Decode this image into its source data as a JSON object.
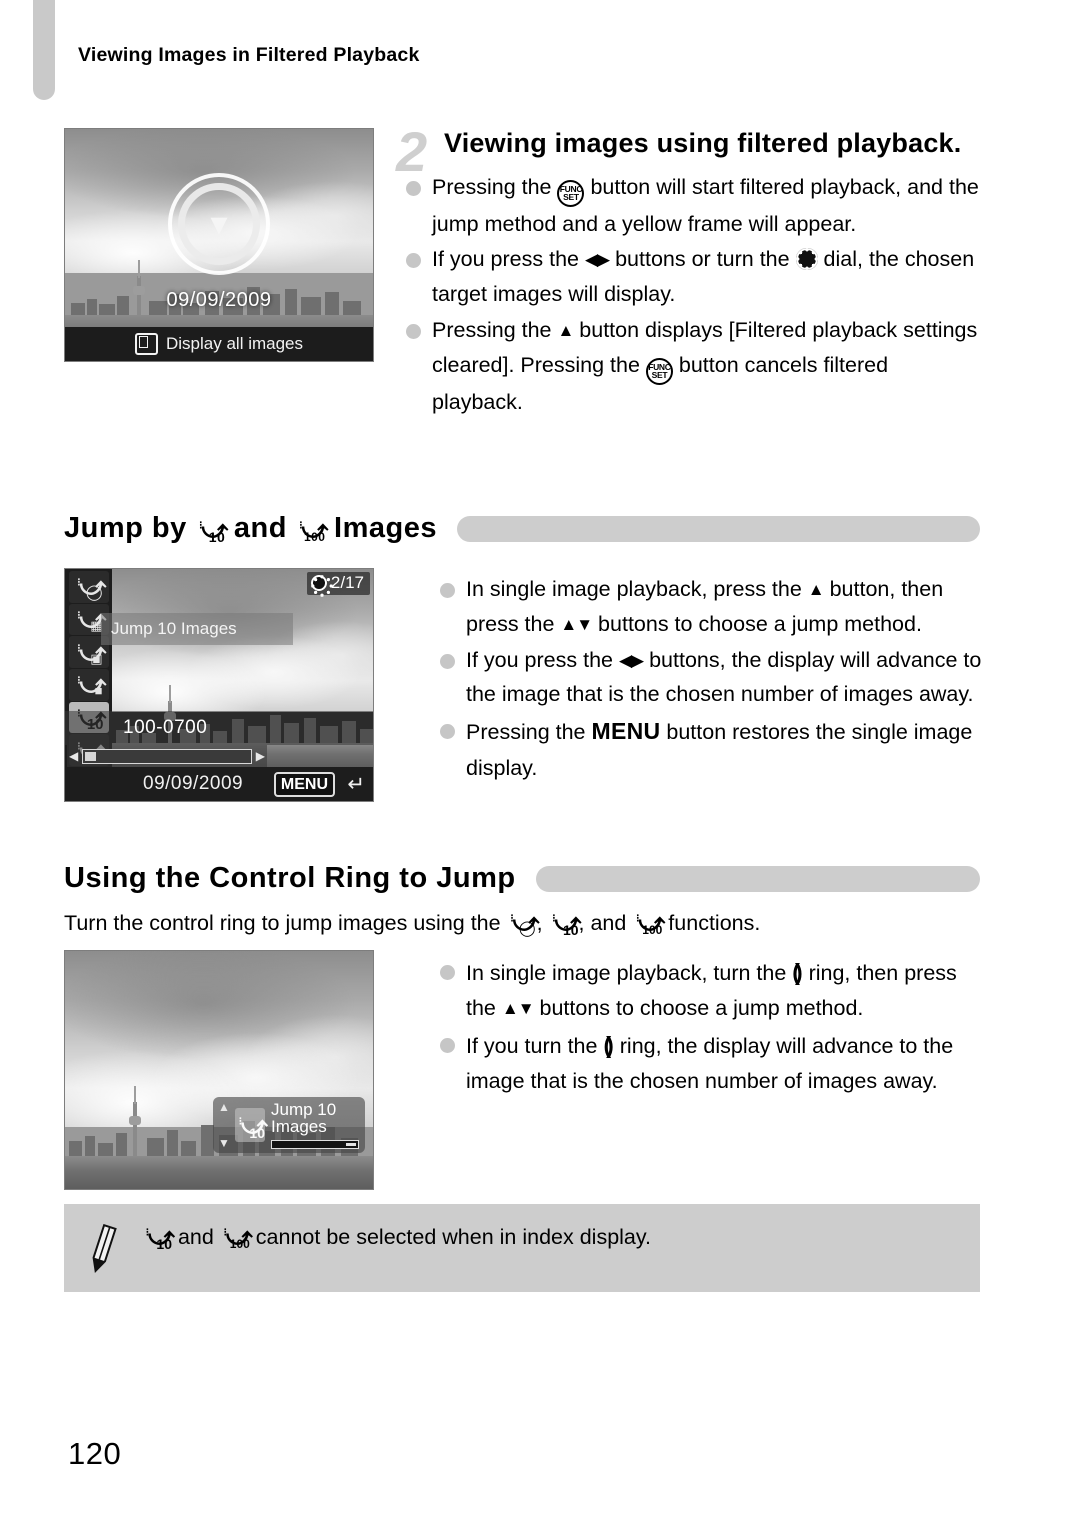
{
  "page": {
    "running_header": "Viewing Images in Filtered Playback",
    "page_number": "120"
  },
  "step": {
    "number": "2",
    "title": "Viewing images using filtered playback.",
    "bullets": [
      {
        "pre": "Pressing the ",
        "icon": "func-set-button-icon",
        "post": " button will start filtered playback, and the jump method and a yellow frame will appear."
      },
      {
        "pre": "If you press the ",
        "icon": "left-right-buttons-icon",
        "mid": " buttons or turn the ",
        "icon2": "control-dial-icon",
        "post": " dial, the chosen target images will display."
      },
      {
        "pre": "Pressing the ",
        "icon": "up-button-icon",
        "mid": " button displays [Filtered playback settings cleared]. Pressing the ",
        "icon2": "func-set-button-icon",
        "post": " button cancels filtered playback."
      }
    ]
  },
  "screen1": {
    "date": "09/09/2009",
    "bottom_label": "Display all images",
    "bottom_icon": "display-all-images-icon",
    "center_icon": "filtered-playback-clock-icon"
  },
  "section_jump": {
    "heading_pre": "Jump by ",
    "heading_icon1": "jump-10-images-icon",
    "heading_mid": " and ",
    "heading_icon2": "jump-100-images-icon",
    "heading_post": " Images",
    "bullets": [
      {
        "pre": "In single image playback, press the ",
        "icon": "up-button-icon",
        "mid": " button, then press the ",
        "icon2": "up-down-buttons-icon",
        "post": " buttons to choose a jump method."
      },
      {
        "pre": "If you press the ",
        "icon": "left-right-buttons-icon",
        "post": " buttons, the display will advance to the image that is the chosen number of images away."
      },
      {
        "pre": "Pressing the ",
        "icon": "menu-button-icon",
        "icon_label": "MENU",
        "post": " button restores the single image display."
      }
    ]
  },
  "screen2": {
    "counter": "2/17",
    "counter_icon": "control-dial-icon",
    "jump_label": "Jump 10 Images",
    "file_number": "100-0700",
    "date": "09/09/2009",
    "menu_label": "MENU",
    "menu_return_icon": "return-arrow-icon",
    "jump_methods": [
      {
        "name": "jump-to-date-icon",
        "glyph": "clock",
        "selected": false
      },
      {
        "name": "jump-to-folder-icon",
        "glyph": "folder",
        "selected": false
      },
      {
        "name": "jump-to-shot-date-icon",
        "glyph": "camera",
        "selected": false
      },
      {
        "name": "jump-to-movie-icon",
        "glyph": "movie",
        "selected": false
      },
      {
        "name": "jump-10-images-icon",
        "glyph": "10",
        "selected": true
      },
      {
        "name": "jump-100-images-icon",
        "glyph": "100",
        "selected": false
      }
    ]
  },
  "section_ring": {
    "heading": "Using the Control Ring to Jump",
    "intro_pre": "Turn the control ring to jump images using the ",
    "intro_icon1": "jump-to-date-icon",
    "intro_sep1": ", ",
    "intro_icon2": "jump-10-images-icon",
    "intro_sep2": ", and ",
    "intro_icon3": "jump-100-images-icon",
    "intro_post": " functions.",
    "bullets": [
      {
        "pre": "In single image playback, turn the ",
        "icon": "control-ring-icon",
        "mid": " ring, then press the ",
        "icon2": "up-down-buttons-icon",
        "post": " buttons to choose a jump method."
      },
      {
        "pre": "If you turn the ",
        "icon": "control-ring-icon",
        "post": " ring, the display will advance to the image that is the chosen number of images away."
      }
    ]
  },
  "screen3": {
    "panel_label": "Jump 10 Images",
    "panel_icon": "jump-10-images-icon",
    "up_icon": "up-arrow-icon",
    "down_icon": "down-arrow-icon"
  },
  "note": {
    "icon": "pencil-note-icon",
    "pre": "",
    "icon1": "jump-10-images-icon",
    "mid": " and ",
    "icon2": "jump-100-images-icon",
    "post": " cannot be selected when in index display."
  },
  "colors": {
    "heading_bar": "#cdcdcd",
    "bullet_dot": "#c6c6c6",
    "step_number": "#cfcfcf",
    "note_bg": "#cdcdcd",
    "margin_tab": "#c9c9c9"
  }
}
